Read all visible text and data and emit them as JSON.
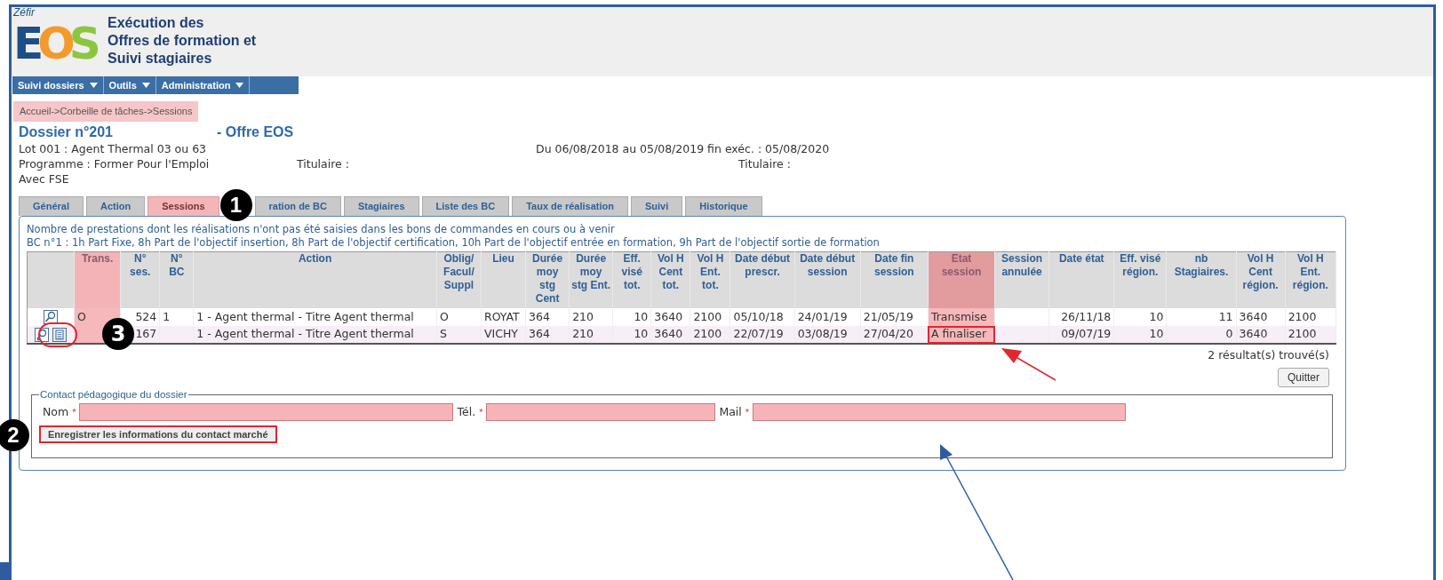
{
  "header": {
    "logo_small": "Zéfir",
    "logo_letters": [
      {
        "text": "E",
        "color": "#1d4f86"
      },
      {
        "text": "O",
        "color": "#f39a2c"
      },
      {
        "text": "S",
        "color": "#8cc63f"
      }
    ],
    "title_lines": [
      "Exécution des",
      "Offres de formation et",
      "Suivi stagiaires"
    ]
  },
  "menu": [
    {
      "label": "Suivi dossiers"
    },
    {
      "label": "Outils"
    },
    {
      "label": "Administration"
    }
  ],
  "breadcrumb": {
    "text": "Accueil->Corbeille de tâches->Sessions",
    "highlighted": true
  },
  "dossier": {
    "title": "Dossier n°201",
    "offer": "- Offre EOS",
    "lot": "Lot 001 : Agent Thermal 03 ou 63",
    "dates": "Du 06/08/2018 au 05/08/2019 fin exéc. : 05/08/2020",
    "programme": "Programme : Former Pour l'Emploi",
    "titulaire_1": "Titulaire :",
    "titulaire_2": "Titulaire :",
    "fse": "Avec FSE"
  },
  "tabs": [
    {
      "label": "Général",
      "selected": false
    },
    {
      "label": "Action",
      "selected": false
    },
    {
      "label": "Sessions",
      "selected": true
    },
    {
      "label": "ration de BC",
      "selected": false
    },
    {
      "label": "Stagiaires",
      "selected": false
    },
    {
      "label": "Liste des BC",
      "selected": false
    },
    {
      "label": "Taux de réalisation",
      "selected": false
    },
    {
      "label": "Suivi",
      "selected": false
    },
    {
      "label": "Historique",
      "selected": false
    }
  ],
  "info_lines": [
    "Nombre de prestations dont les réalisations n'ont pas été saisies dans les bons de commandes en cours ou à venir",
    "BC n°1 : 1h Part Fixe, 8h Part de l'objectif insertion, 8h Part de l'objectif certification, 10h Part de l'objectif entrée en formation, 9h Part de l'objectif sortie de formation"
  ],
  "table": {
    "columns": [
      {
        "highlighted": false
      },
      {
        "label": "Trans.",
        "highlighted": true
      },
      {
        "label": "N° ses.",
        "highlighted": false
      },
      {
        "label": "N° BC",
        "highlighted": false
      },
      {
        "label": "Action",
        "highlighted": false
      },
      {
        "label": "Oblig/ Facul/ Suppl",
        "highlighted": false
      },
      {
        "label": "Lieu",
        "highlighted": false
      },
      {
        "label": "Durée moy stg Cent",
        "highlighted": false
      },
      {
        "label": "Durée moy stg Ent.",
        "highlighted": false
      },
      {
        "label": "Eff. visé tot.",
        "highlighted": false
      },
      {
        "label": "Vol H Cent tot.",
        "highlighted": false
      },
      {
        "label": "Vol H Ent. tot.",
        "highlighted": false
      },
      {
        "label": "Date début prescr.",
        "highlighted": false
      },
      {
        "label": "Date début session",
        "highlighted": false
      },
      {
        "label": "Date fin session",
        "highlighted": false
      },
      {
        "label": "Etat session",
        "highlighted": true
      },
      {
        "label": "Session annulée",
        "highlighted": false
      },
      {
        "label": "Date état",
        "highlighted": false
      },
      {
        "label": "Eff. visé région.",
        "highlighted": false
      },
      {
        "label": "nb Stagiaires.",
        "highlighted": false
      },
      {
        "label": "Vol H Cent région.",
        "highlighted": false
      },
      {
        "label": "Vol H Ent. région.",
        "highlighted": false
      }
    ],
    "rows": [
      {
        "actions": [
          {
            "kind": "search"
          }
        ],
        "alternate": false,
        "state_boxed": false,
        "icons_circled": false,
        "cells": [
          "",
          "O",
          "524",
          "1",
          "1 - Agent thermal - Titre Agent thermal",
          "O",
          "ROYAT",
          "364",
          "210",
          "10",
          "3640",
          "2100",
          "05/10/18",
          "24/01/19",
          "21/05/19",
          "Transmise",
          "",
          "26/11/18",
          "10",
          "11",
          "3640",
          "2100"
        ]
      },
      {
        "actions": [
          {
            "kind": "edit"
          },
          {
            "kind": "document"
          }
        ],
        "alternate": true,
        "state_boxed": true,
        "icons_circled": true,
        "cells": [
          "",
          "",
          "167",
          "",
          "1 - Agent thermal - Titre Agent thermal",
          "S",
          "VICHY",
          "364",
          "210",
          "10",
          "3640",
          "2100",
          "22/07/19",
          "03/08/19",
          "27/04/20",
          "A finaliser",
          "",
          "09/07/19",
          "10",
          "0",
          "3640",
          "2100"
        ]
      }
    ]
  },
  "result_count": "2 résultat(s) trouvé(s)",
  "quit_button": "Quitter",
  "contact": {
    "legend": "Contact pédagogique du dossier",
    "fields": [
      {
        "label": "Nom",
        "required_mark": "*",
        "highlighted": true
      },
      {
        "label": "Tél.",
        "required_mark": "*",
        "highlighted": true
      },
      {
        "label": "Mail",
        "required_mark": "*",
        "highlighted": true
      }
    ],
    "save_button": "Enregistrer les informations du contact marché",
    "save_boxed": true
  },
  "callouts": [
    "1",
    "2",
    "3"
  ]
}
